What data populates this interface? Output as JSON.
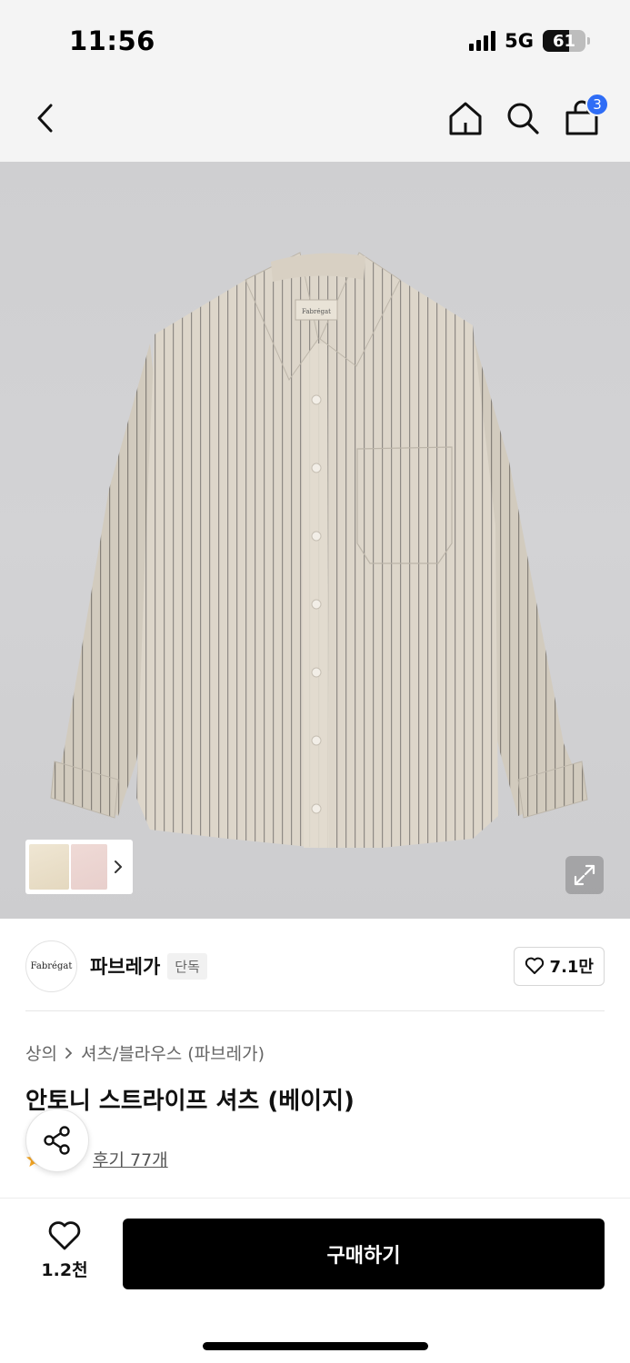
{
  "status_bar": {
    "time": "11:56",
    "network": "5G",
    "battery": "61",
    "battery_level": 0.61
  },
  "nav": {
    "back_icon": "chevron-left-icon",
    "home_icon": "home-icon",
    "search_icon": "search-icon",
    "cart_icon": "shopping-bag-icon",
    "cart_count": "3"
  },
  "product_image": {
    "label_text": "Fabrégat",
    "expand_icon": "expand-icon",
    "thumb_chevron_icon": "chevron-right-icon"
  },
  "brand": {
    "logo_text": "Fabrégat",
    "name": "파브레가",
    "tag": "단독",
    "follow_count": "7.1만"
  },
  "breadcrumb": {
    "category": "상의",
    "subcategory": "셔츠/블라우스 (파브레가)"
  },
  "product": {
    "title": "안토니 스트라이프 셔츠 (베이지)",
    "review_link": "후기 77개"
  },
  "bottom_bar": {
    "like_count": "1.2천",
    "buy_label": "구매하기"
  },
  "colors": {
    "accent": "#2f6df6",
    "buy_button": "#000000",
    "hero_bg": "#d0d0d2",
    "shirt": "#ddd6ca"
  }
}
